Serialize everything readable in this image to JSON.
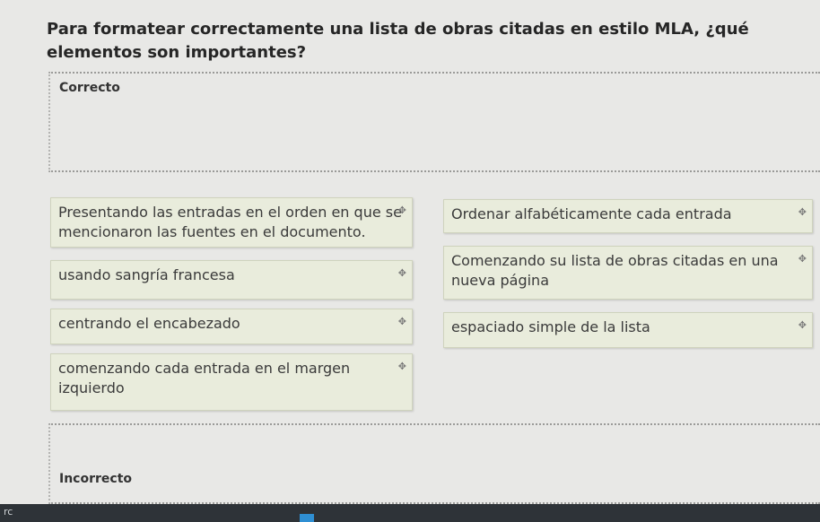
{
  "question": "Para formatear correctamente una lista de obras citadas en estilo MLA, ¿qué elementos son importantes?",
  "zones": {
    "correct_label": "Correcto",
    "incorrect_label": "Incorrecto"
  },
  "cards": [
    {
      "text": "Presentando las entradas en el orden en que se mencionaron las fuentes en el documento."
    },
    {
      "text": "Ordenar alfabéticamente cada entrada"
    },
    {
      "text": "Comenzando su lista de obras citadas en una nueva página"
    },
    {
      "text": "usando sangría francesa"
    },
    {
      "text": "centrando el encabezado"
    },
    {
      "text": "espaciado simple de la lista"
    },
    {
      "text": "comenzando cada entrada en el margen izquierdo"
    }
  ],
  "drag_handle_icon": "move-icon",
  "bottom_bar": {
    "text": "rc"
  }
}
